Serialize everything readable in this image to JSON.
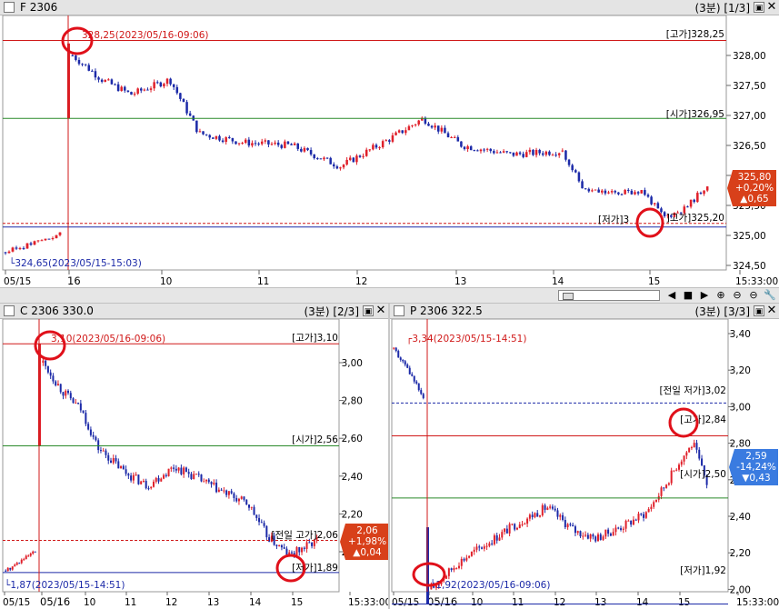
{
  "panels": {
    "f": {
      "title": "F 2306",
      "meta": "(3분) [1/3]",
      "high_label": "328,25(2023/05/16-09:06)",
      "low_label": "324,65(2023/05/15-15:03)",
      "line_high": "[고가]328,25",
      "line_open": "[시가]326,95",
      "line_low": "[저가]3",
      "line_low_suffix": "]고가]325,20",
      "price_tag": {
        "price": "325,80",
        "change_pct": "+0,20%",
        "change": "▲0,65"
      },
      "y_ticks": [
        "328,00",
        "327,50",
        "327,00",
        "326,50",
        "326,00",
        "325,50",
        "325,00",
        "324,50"
      ],
      "x_ticks": [
        "05/15",
        "16",
        "10",
        "11",
        "12",
        "13",
        "14",
        "15",
        "15:33:00"
      ]
    },
    "c": {
      "title": "C 2306 330.0",
      "meta": "(3분) [2/3]",
      "high_label": "3,10(2023/05/16-09:06)",
      "low_label": "1,87(2023/05/15-14:51)",
      "line_high": "[고가]3,10",
      "line_open": "[시가]2,56",
      "line_prev_high": "[전일 고가]2,06",
      "line_low": "[저가]1,89",
      "price_tag": {
        "price": "2,06",
        "change_pct": "+1,98%",
        "change": "▲0,04"
      },
      "y_ticks": [
        "3,00",
        "2,80",
        "2,60",
        "2,40",
        "2,20",
        "2,00"
      ],
      "x_ticks": [
        "05/15",
        "05/16",
        "10",
        "11",
        "12",
        "13",
        "14",
        "15",
        "15:33:00"
      ]
    },
    "p": {
      "title": "P 2306 322.5",
      "meta": "(3분) [3/3]",
      "high_label": "3,34(2023/05/15-14:51)",
      "low_label": "1,92(2023/05/16-09:06)",
      "line_prev_low": "[전일 저가]3,02",
      "line_high": "[고가]2,84",
      "line_open": "[시가]2,50",
      "line_low": "[저가]1,92",
      "price_tag": {
        "price": "2,59",
        "change_pct": "-14,24%",
        "change": "▼0,43"
      },
      "y_ticks": [
        "3,40",
        "3,20",
        "3,00",
        "2,80",
        "2,60",
        "2,40",
        "2,20",
        "2,00"
      ],
      "x_ticks": [
        "05/15",
        "05/16",
        "10",
        "11",
        "12",
        "13",
        "14",
        "15",
        "15:33:00"
      ]
    }
  },
  "toolbar": {
    "buttons": [
      "◀",
      "■",
      "▶",
      "⊕",
      "⊖",
      "⊖",
      "🔧"
    ]
  },
  "colors": {
    "up": "#e0202a",
    "down": "#1c2aa8",
    "high_line": "#d01818",
    "open_line": "#2a8a2a",
    "low_line": "#1c2aa8",
    "tag_up": "#d8401a",
    "tag_down": "#3a7be0",
    "circle": "#e0101a"
  }
}
